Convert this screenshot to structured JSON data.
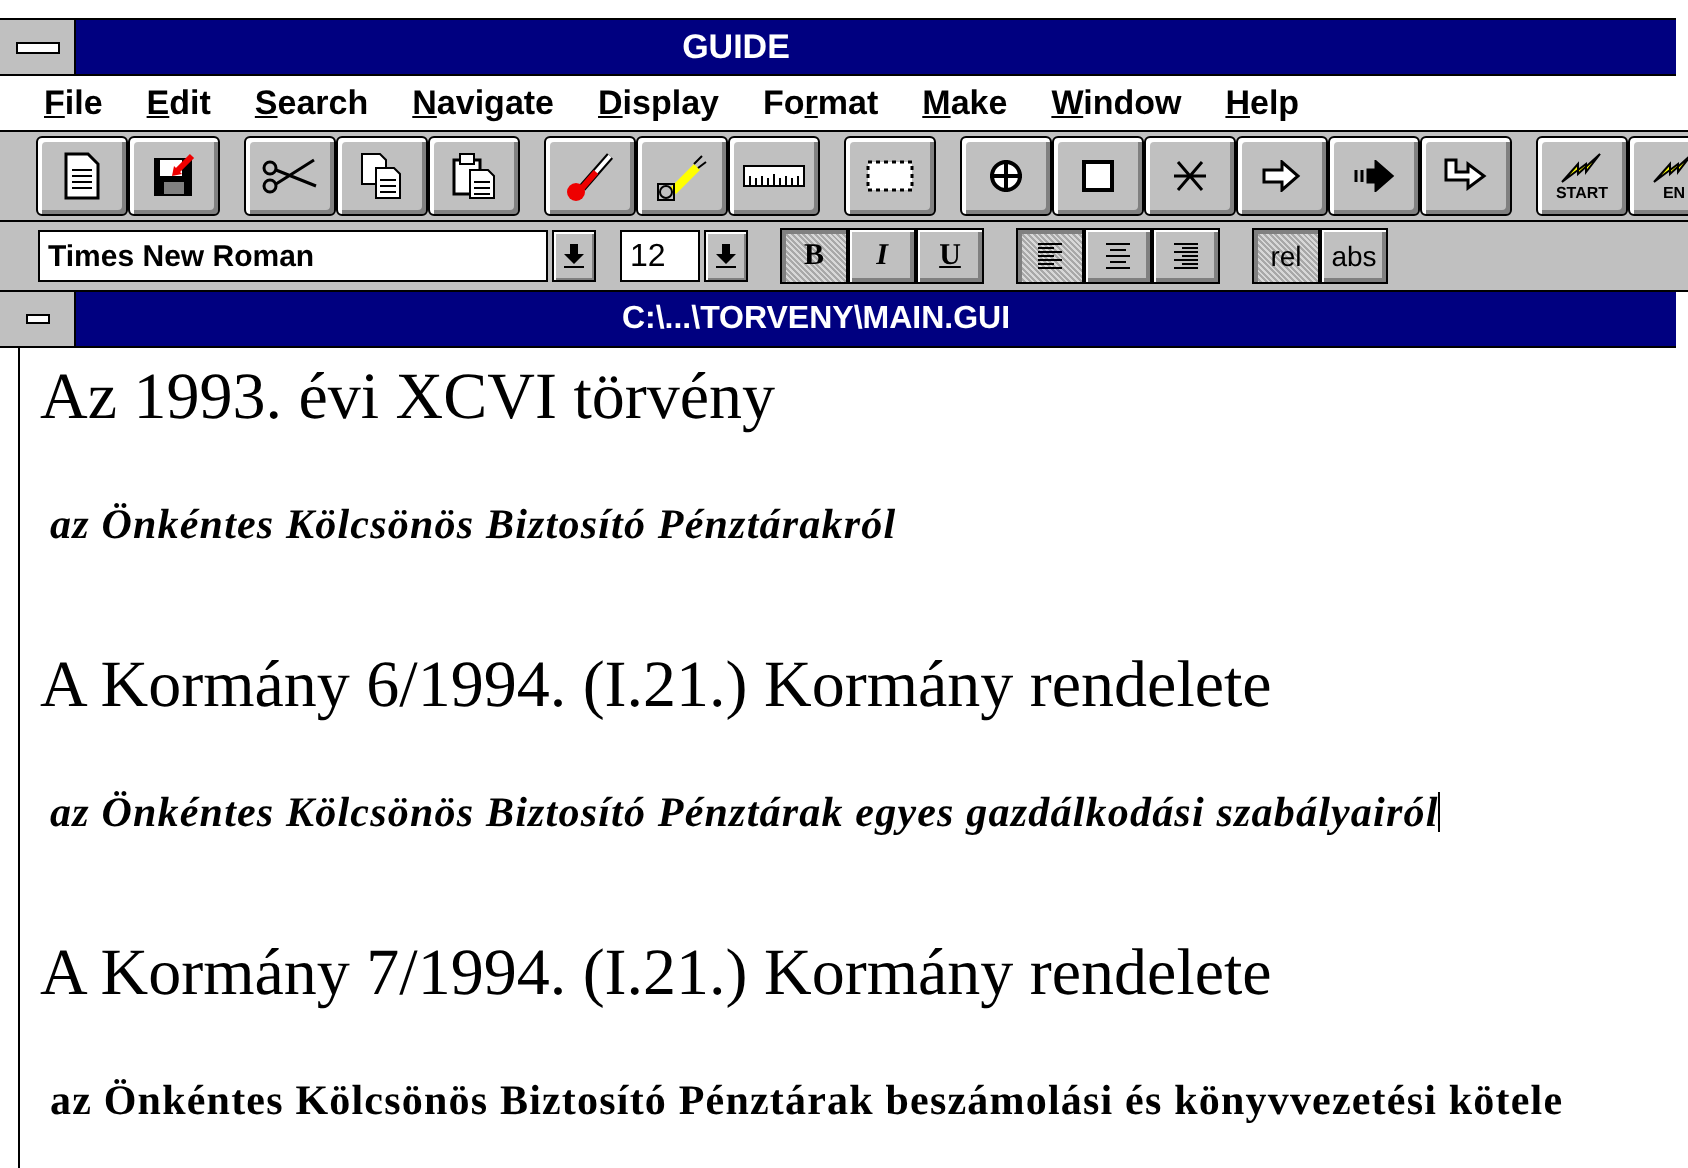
{
  "window": {
    "title": "GUIDE"
  },
  "menu": [
    {
      "key": "F",
      "after": "ile"
    },
    {
      "key": "E",
      "after": "dit"
    },
    {
      "key": "S",
      "after": "earch"
    },
    {
      "key": "N",
      "after": "avigate"
    },
    {
      "key": "D",
      "after": "isplay"
    },
    {
      "before": "Fo",
      "key": "r",
      "after": "mat"
    },
    {
      "key": "M",
      "after": "ake"
    },
    {
      "key": "W",
      "after": "indow"
    },
    {
      "key": "H",
      "after": "elp"
    }
  ],
  "toolbar": [
    {
      "buttons": [
        {
          "kind": "page"
        },
        {
          "kind": "disk"
        }
      ]
    },
    {
      "buttons": [
        {
          "kind": "scissors"
        },
        {
          "kind": "copy"
        },
        {
          "kind": "paste"
        }
      ]
    },
    {
      "buttons": [
        {
          "kind": "thermometer"
        },
        {
          "kind": "lamp"
        },
        {
          "kind": "ruler"
        }
      ]
    },
    {
      "buttons": [
        {
          "kind": "marquee"
        }
      ]
    },
    {
      "buttons": [
        {
          "kind": "crosshair"
        },
        {
          "kind": "square"
        },
        {
          "kind": "star"
        },
        {
          "kind": "arrow"
        },
        {
          "kind": "dasharrow"
        },
        {
          "kind": "bentarrow"
        }
      ]
    },
    {
      "buttons": [
        {
          "kind": "bolt",
          "label": "START"
        },
        {
          "kind": "bolt",
          "label": "EN"
        }
      ]
    }
  ],
  "format_bar": {
    "font": "Times New Roman",
    "size": "12",
    "styles": [
      {
        "label": "B",
        "kind": "bold",
        "selected": true
      },
      {
        "label": "I",
        "kind": "italic",
        "selected": false
      },
      {
        "label": "U",
        "kind": "underline",
        "selected": false
      }
    ],
    "align": [
      {
        "kind": "left",
        "selected": true
      },
      {
        "kind": "center",
        "selected": false
      },
      {
        "kind": "right",
        "selected": false
      }
    ],
    "units": [
      {
        "label": "rel",
        "selected": true
      },
      {
        "label": "abs",
        "selected": false
      }
    ]
  },
  "document": {
    "title": "C:\\...\\TORVENY\\MAIN.GUI",
    "lines": [
      {
        "kind": "heading",
        "text": "Az 1993. évi XCVI törvény"
      },
      {
        "kind": "subtitle_italic",
        "text": "az Önkéntes Kölcsönös Biztosító Pénztárakról"
      },
      {
        "kind": "heading",
        "text": "A Kormány 6/1994. (I.21.) Kormány rendelete"
      },
      {
        "kind": "subtitle_italic",
        "text": "az Önkéntes Kölcsönös Biztosító Pénztárak egyes gazdálkodási szabályairól",
        "caret": true
      },
      {
        "kind": "heading",
        "text": "A Kormány 7/1994. (I.21.) Kormány rendelete"
      },
      {
        "kind": "subtitle",
        "text": "az Önkéntes Kölcsönös Biztosító Pénztárak beszámolási és könyvvezetési kötele"
      }
    ]
  }
}
